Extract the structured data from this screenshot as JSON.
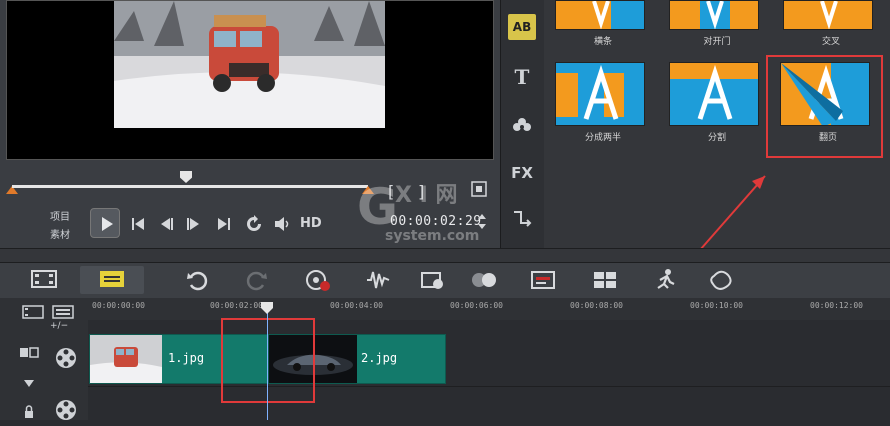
{
  "preview": {
    "mode_project": "项目",
    "mode_clip": "素材",
    "timecode": "00:00:02:29",
    "hd_label": "HD"
  },
  "library": {
    "transitions": [
      {
        "label": "横条"
      },
      {
        "label": "对开门"
      },
      {
        "label": "交叉"
      },
      {
        "label": "分成两半"
      },
      {
        "label": "分割"
      },
      {
        "label": "翻页"
      }
    ],
    "sidebar_icons": [
      "transition-ab-icon",
      "title-t-icon",
      "graphics-flower-icon",
      "fx-filter-icon",
      "path-icon"
    ],
    "fx_label": "FX",
    "ab_label": "AB",
    "t_label": "T"
  },
  "timeline": {
    "undo_label": "+/−",
    "ruler_ticks": [
      "00:00:00:00",
      "00:00:02:00",
      "00:00:04:00",
      "00:00:06:00",
      "00:00:08:00",
      "00:00:10:00",
      "00:00:12:00"
    ],
    "clips": [
      {
        "label": "1.jpg"
      },
      {
        "label": "2.jpg"
      }
    ]
  },
  "watermark": {
    "text": "G X I 网",
    "sub": "system.com"
  },
  "colors": {
    "accent_orange": "#e07a2a",
    "tile_blue": "#1e9dd9",
    "tile_orange": "#f39a1e",
    "clip_teal": "#137a6b",
    "highlight_red": "#e03a3a"
  }
}
